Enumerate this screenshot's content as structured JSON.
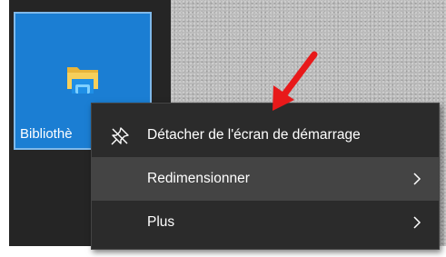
{
  "tile": {
    "label": "Bibliothè",
    "icon": "library-folder-icon",
    "color": "#1b7ed3"
  },
  "context_menu": {
    "items": [
      {
        "label": "Détacher de l'écran de démarrage",
        "icon": "unpin-icon",
        "has_submenu": false
      },
      {
        "label": "Redimensionner",
        "icon": "",
        "has_submenu": true,
        "highlighted": true
      },
      {
        "label": "Plus",
        "icon": "",
        "has_submenu": true
      }
    ],
    "background": "#2b2b2b",
    "highlight": "#444444"
  },
  "annotation": {
    "arrow_color": "#e8191a"
  }
}
